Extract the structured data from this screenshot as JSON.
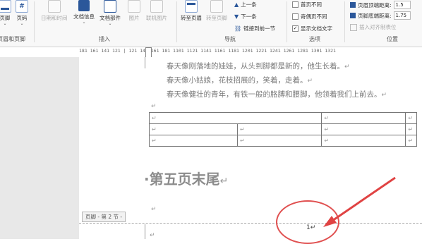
{
  "colors": {
    "accent": "#2b579a",
    "annotation": "#e04343",
    "ribbon_bg": "#f8f8f8"
  },
  "ribbon": {
    "groups": {
      "header_footer": "页眉和页脚",
      "insert": "插入",
      "navigation": "导航",
      "options": "选项",
      "position": "位置"
    },
    "buttons": {
      "footer": "页脚",
      "page_number": "页码",
      "date_time": "日期和时间",
      "doc_info": "文档信息",
      "doc_parts": "文档部件",
      "picture": "图片",
      "online_picture": "联机图片",
      "go_to_header": "转至页眉",
      "go_to_footer": "转至页脚",
      "previous": "上一条",
      "next": "下一条",
      "link_to_previous": "链接到前一节"
    },
    "options": {
      "different_first_page": "首页不同",
      "different_odd_even": "奇偶页不同",
      "show_document_text": "显示文档文字",
      "show_document_text_checked": true
    },
    "position": {
      "header_top_label": "页眉顶端距离:",
      "header_top_value": "1.5",
      "footer_bottom_label": "页脚底端距离:",
      "footer_bottom_value": "1.75",
      "insert_alignment_tab": "插入对齐制表位"
    }
  },
  "ruler": {
    "text": "181 161 141 121 | 121 141 161 181 1101 1121 1141 1161 1181 1201 1221 1241 1261 1281 1301 1321"
  },
  "document": {
    "paragraphs": [
      "春天像刚落地的娃娃，从头到脚都是新的，他生长着。",
      "春天像小姑娘，花枝招展的，笑着，走着。",
      "春天像健壮的青年，有铁一般的胳膊和腰脚，他领着我们上前去。"
    ],
    "para_mark": "↵",
    "heading": "·第五页末尾",
    "footer_label": "页脚 - 第 2 节 -",
    "page_number": "1"
  }
}
